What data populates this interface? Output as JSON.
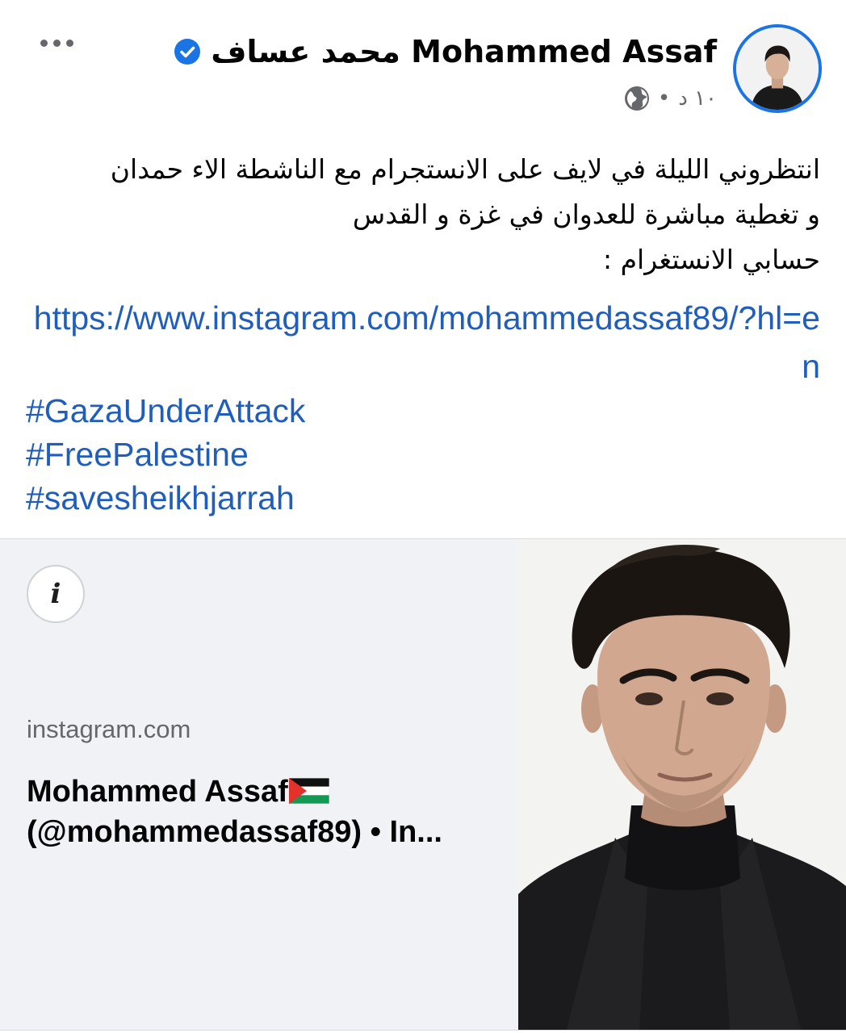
{
  "header": {
    "author_name": "محمد عساف Mohammed Assaf",
    "verified": true,
    "timestamp": "١٠ د",
    "separator": "•",
    "audience_icon": "globe-icon",
    "more_icon": "more-options-icon"
  },
  "post": {
    "text_lines": [
      "انتظروني الليلة في لايف على الانستجرام مع الناشطة الاء حمدان",
      "و تغطية مباشرة للعدوان في غزة و القدس",
      "حسابي الانستغرام :"
    ],
    "link": "https://www.instagram.com/mohammedassaf89/?hl=en",
    "hashtags": [
      "#GazaUnderAttack",
      "#FreePalestine",
      "#savesheikhjarrah"
    ]
  },
  "link_preview": {
    "info_icon": "info-icon",
    "info_glyph": "i",
    "domain": "instagram.com",
    "title_part1": "Mohammed Assaf",
    "flag_icon": "palestine-flag-icon",
    "title_part2": "(@mohammedassaf89) • In..."
  },
  "colors": {
    "link": "#1f5ebd",
    "verified": "#1b74e4",
    "preview_bg": "#f0f2f5",
    "meta_text": "#65676b"
  }
}
